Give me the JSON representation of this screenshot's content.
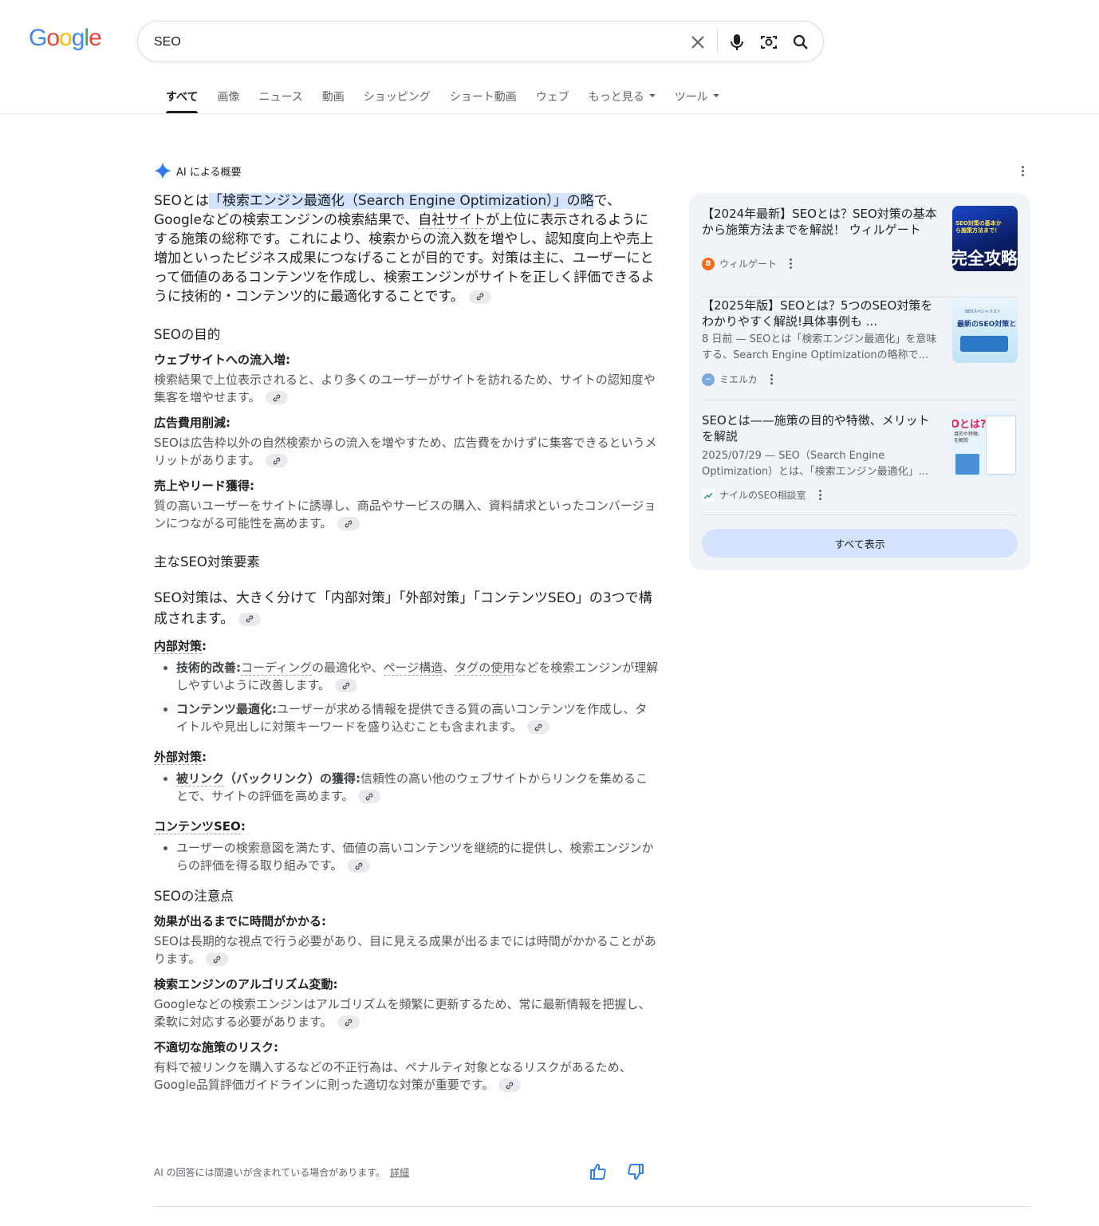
{
  "logo": {
    "letters": [
      "G",
      "o",
      "o",
      "g",
      "l",
      "e"
    ],
    "colors": [
      "#4285F4",
      "#EA4335",
      "#FBBC05",
      "#4285F4",
      "#34A853",
      "#EA4335"
    ]
  },
  "search": {
    "value": "SEO"
  },
  "tabs": [
    {
      "label": "すべて",
      "active": true
    },
    {
      "label": "画像"
    },
    {
      "label": "ニュース"
    },
    {
      "label": "動画"
    },
    {
      "label": "ショッピング"
    },
    {
      "label": "ショート動画"
    },
    {
      "label": "ウェブ"
    },
    {
      "label": "もっと見る",
      "dropdown": true
    },
    {
      "label": "ツール",
      "dropdown": true
    }
  ],
  "ai": {
    "header": "AI による概要",
    "intro": {
      "pre": "SEOとは",
      "highlight": "「検索エンジン最適化（Search Engine Optimization）」の略",
      "mid1": "で、Googleなどの検索エンジンの検索結果で、",
      "link1": "自社サイト",
      "rest": "が上位に表示されるようにする施策の総称です。これにより、検索からの流入数を増やし、認知度向上や売上増加といったビジネス成果につなげることが目的です。対策は主に、ユーザーにとって価値のあるコンテンツを作成し、検索エンジンがサイトを正しく評価できるように技術的・コンテンツ的に最適化することです。"
    },
    "purpose": {
      "heading": "SEOの目的",
      "items": [
        {
          "title": "ウェブサイトへの流入増:",
          "text": "検索結果で上位表示されると、より多くのユーザーがサイトを訪れるため、サイトの認知度や集客を増やせます。"
        },
        {
          "title": "広告費用削減:",
          "text": "SEOは広告枠以外の自然検索からの流入を増やすため、広告費をかけずに集客できるというメリットがあります。"
        },
        {
          "title": "売上やリード獲得:",
          "text": "質の高いユーザーをサイトに誘導し、商品やサービスの購入、資料請求といったコンバージョンにつながる可能性を高めます。"
        }
      ]
    },
    "elements": {
      "heading": "主なSEO対策要素",
      "lead": "SEO対策は、大きく分けて「内部対策」「外部対策」「コンテンツSEO」の3つで構成されます。",
      "internal": {
        "title": "内部対策",
        "items": [
          {
            "bold": "技術的改善:",
            "l1": "コーディング",
            "t1": "の最適化や、",
            "l2": "ページ構造",
            "t2": "、",
            "l3": "タグの使用",
            "t3": "などを検索エンジンが理解しやすいように改善します。"
          },
          {
            "bold": "コンテンツ最適化:",
            "text": "ユーザーが求める情報を提供できる質の高いコンテンツを作成し、タイトルや見出しに対策キーワードを盛り込むことも含まれます。"
          }
        ]
      },
      "external": {
        "title": "外部対策",
        "items": [
          {
            "bold1": "被リンク",
            "bold2": "（バックリンク）の獲得:",
            "text": "信頼性の高い他のウェブサイトからリンクを集めることで、サイトの評価を高めます。"
          }
        ]
      },
      "content": {
        "title": "コンテンツSEO",
        "items": [
          {
            "text": "ユーザーの検索意図を満たす、価値の高いコンテンツを継続的に提供し、検索エンジンからの評価を得る取り組みです。"
          }
        ]
      }
    },
    "cautions": {
      "heading": "SEOの注意点",
      "items": [
        {
          "title": "効果が出るまでに時間がかかる:",
          "text": "SEOは長期的な視点で行う必要があり、目に見える成果が出るまでには時間がかかることがあります。"
        },
        {
          "title": "検索エンジンのアルゴリズム変動:",
          "text": "Googleなどの検索エンジンはアルゴリズムを頻繁に更新するため、常に最新情報を把握し、柔軟に対応する必要があります。"
        },
        {
          "title": "不適切な施策のリスク:",
          "text": "有料で被リンクを購入するなどの不正行為は、ペナルティ対象となるリスクがあるため、Google品質評価ガイドラインに則った適切な対策が重要です。"
        }
      ]
    },
    "disclaimer": "AI の回答には間違いが含まれている場合があります。",
    "details": "詳細"
  },
  "sources": {
    "items": [
      {
        "title": "【2024年最新】SEOとは？SEO対策の基本から施策方法までを解説！ ウィルゲート",
        "snippet": "",
        "site": "ウィルゲート",
        "fav_color": "#f26b1d",
        "thumb_text": "完全攻略",
        "thumb_sub": "SEO対策の基本から施策方法まで！"
      },
      {
        "title": "【2025年版】SEOとは？5つのSEO対策をわかりやすく解説!具体事例も ...",
        "snippet": "8 日前 — SEOとは「検索エンジン最適化」を意味する、Search Engine Optimizationの略称で...",
        "site": "ミエルカ",
        "fav_color": "#7fa7e0",
        "thumb_text": "最新のSEO対策と",
        "thumb_sub": "SEOスペシャリスト"
      },
      {
        "title": "SEOとは——施策の目的や特徴、メリットを解説",
        "snippet": "2025/07/29 — SEO（Search Engine Optimization）とは、「検索エンジン最適化」...",
        "site": "ナイルのSEO相談室",
        "fav_color": "#2e9e6a",
        "thumb_text": "Oとは?",
        "thumb_sub": "目的や特徴、を解説"
      }
    ],
    "show_all": "すべて表示"
  }
}
